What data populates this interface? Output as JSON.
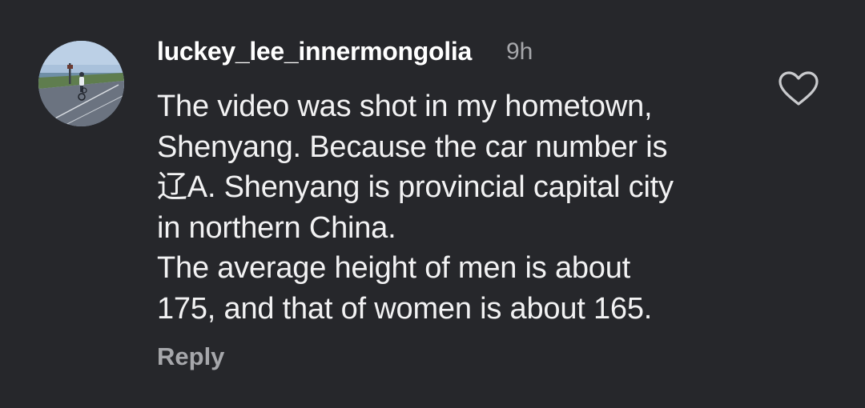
{
  "comment": {
    "author": "luckey_lee_innermongolia",
    "time": "9h",
    "text": "The video was shot in my hometown,\nShenyang. Because the car number is\n辽A. Shenyang is provincial capital city\nin northern China.\nThe average height of men is about\n175, and that of women is about 165.",
    "reply_label": "Reply",
    "like_icon": "heart-outline-icon",
    "avatar_icon": "profile-photo-cyclist"
  },
  "colors": {
    "background": "#26272b",
    "primary_text": "#ffffff",
    "secondary_text": "#a6a7ab",
    "icon": "#c9cacd"
  }
}
